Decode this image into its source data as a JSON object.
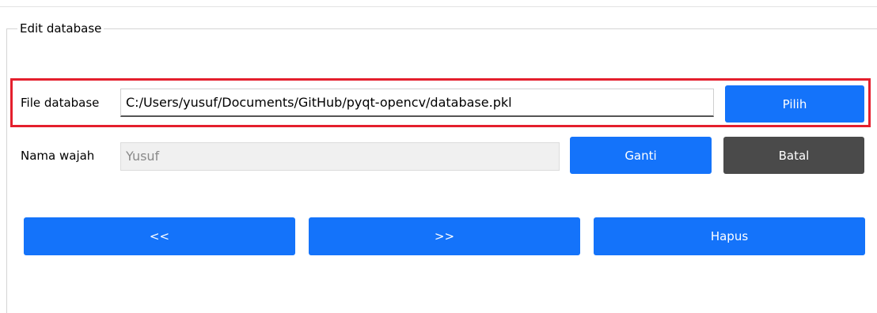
{
  "groupbox": {
    "title": "Edit database"
  },
  "file_row": {
    "label": "File database",
    "value": "C:/Users/yusuf/Documents/GitHub/pyqt-opencv/database.pkl",
    "button_label": "Pilih"
  },
  "name_row": {
    "label": "Nama wajah",
    "value": "Yusuf",
    "change_button_label": "Ganti",
    "cancel_button_label": "Batal"
  },
  "nav": {
    "prev_label": "<<",
    "next_label": ">>",
    "delete_label": "Hapus"
  },
  "colors": {
    "primary_button": "#1473fa",
    "secondary_button": "#4a4a4a",
    "highlight_border": "#e41f2d"
  }
}
